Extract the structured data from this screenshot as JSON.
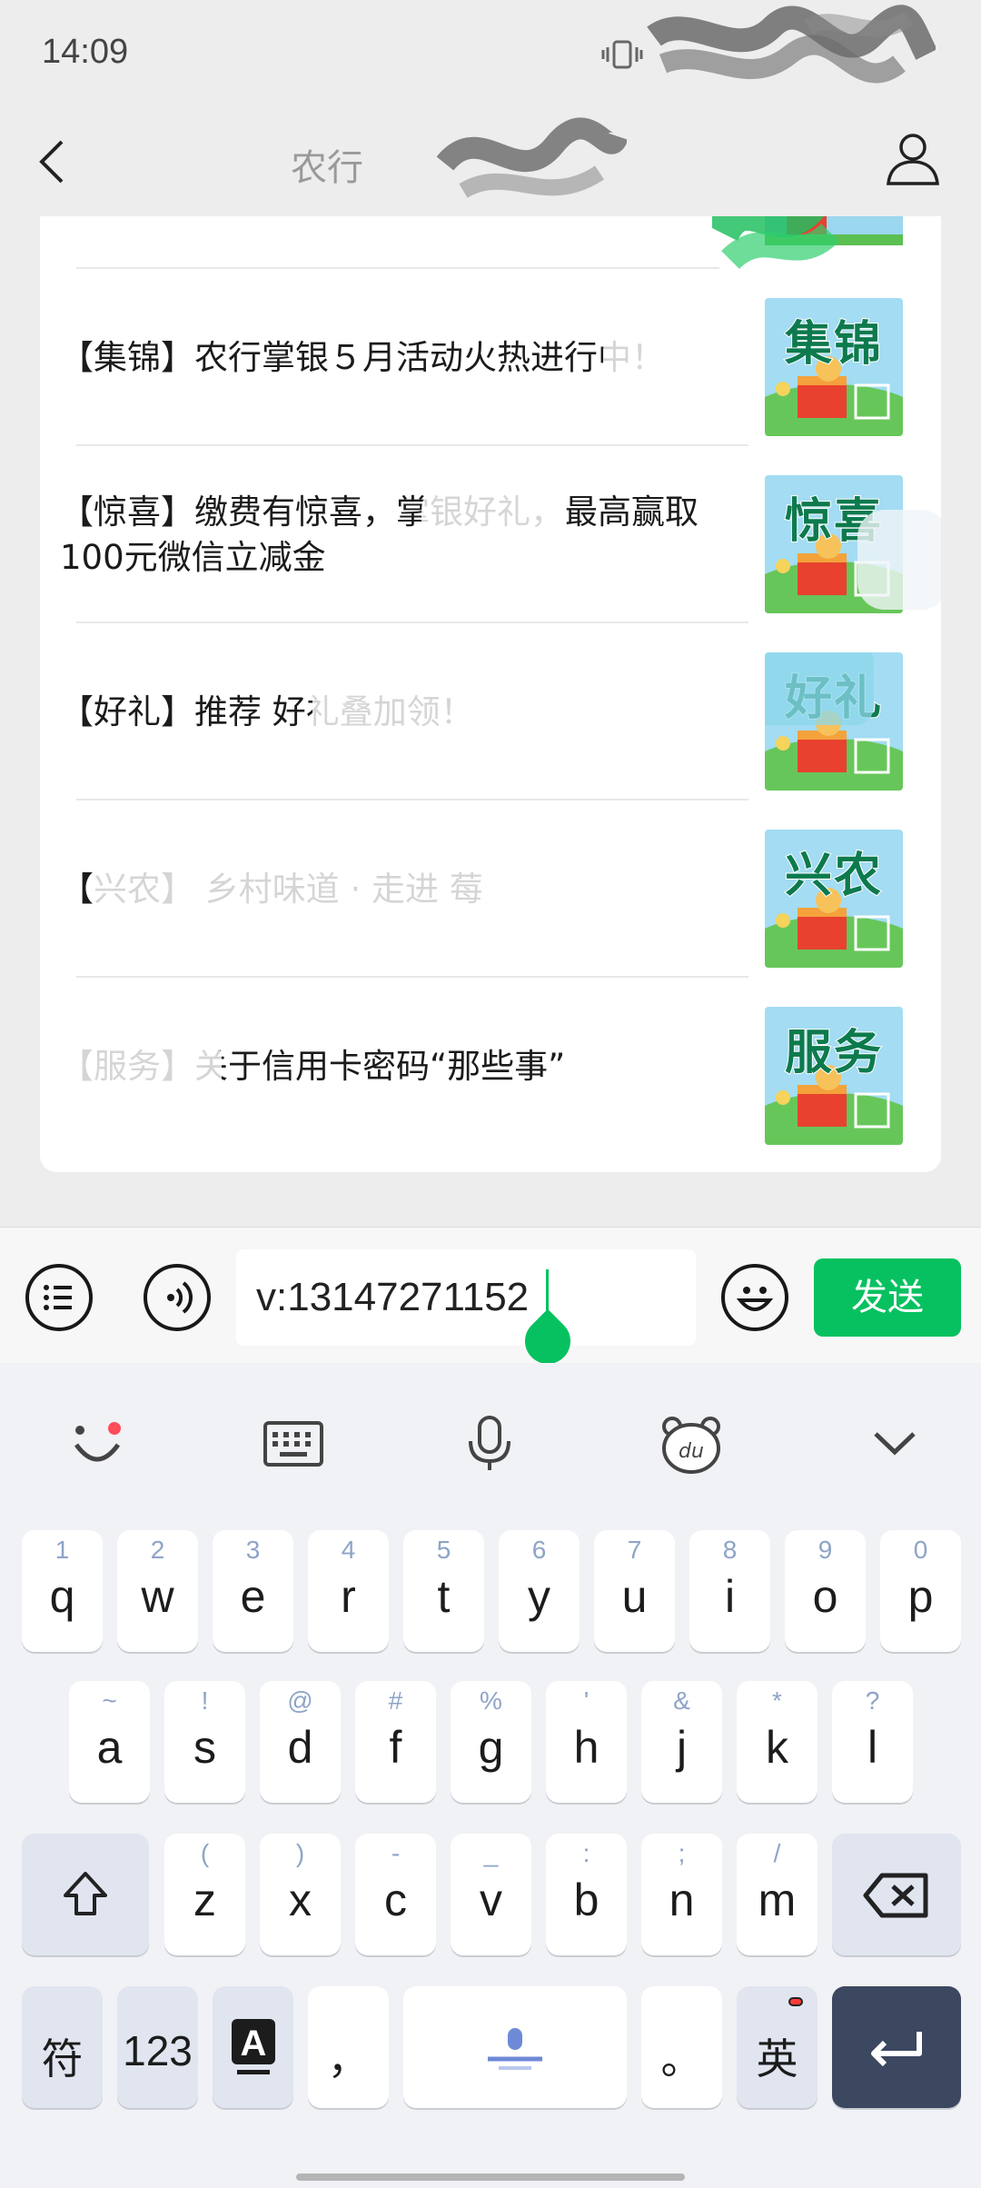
{
  "status_bar": {
    "time": "14:09"
  },
  "nav": {
    "title": "农行 "
  },
  "articles": [
    {
      "title": "【集锦】农行掌银５月活动火热进行中！",
      "thumb": "集锦"
    },
    {
      "title": "【惊喜】缴费有惊喜，掌银好礼，最高赢取100元微信立减金",
      "thumb": "惊喜"
    },
    {
      "title": "【好礼】推荐 好礼叠加领！",
      "thumb": "好礼"
    },
    {
      "title": "【兴农】 乡村味道 · 走进 莓",
      "thumb": "兴农"
    },
    {
      "title": "【服务】关于信用卡密码“那些事”",
      "thumb": "服务"
    }
  ],
  "input": {
    "value": "v:13147271152",
    "send_label": "发送"
  },
  "keyboard": {
    "row1": [
      {
        "hint": "1",
        "char": "q"
      },
      {
        "hint": "2",
        "char": "w"
      },
      {
        "hint": "3",
        "char": "e"
      },
      {
        "hint": "4",
        "char": "r"
      },
      {
        "hint": "5",
        "char": "t"
      },
      {
        "hint": "6",
        "char": "y"
      },
      {
        "hint": "7",
        "char": "u"
      },
      {
        "hint": "8",
        "char": "i"
      },
      {
        "hint": "9",
        "char": "o"
      },
      {
        "hint": "0",
        "char": "p"
      }
    ],
    "row2": [
      {
        "hint": "~",
        "char": "a"
      },
      {
        "hint": "!",
        "char": "s"
      },
      {
        "hint": "@",
        "char": "d"
      },
      {
        "hint": "#",
        "char": "f"
      },
      {
        "hint": "%",
        "char": "g"
      },
      {
        "hint": "'",
        "char": "h"
      },
      {
        "hint": "&",
        "char": "j"
      },
      {
        "hint": "*",
        "char": "k"
      },
      {
        "hint": "?",
        "char": "l"
      }
    ],
    "row3": [
      {
        "hint": "(",
        "char": "z"
      },
      {
        "hint": ")",
        "char": "x"
      },
      {
        "hint": "-",
        "char": "c"
      },
      {
        "hint": "_",
        "char": "v"
      },
      {
        "hint": ":",
        "char": "b"
      },
      {
        "hint": ";",
        "char": "n"
      },
      {
        "hint": "/",
        "char": "m"
      }
    ],
    "symbols_label": "符",
    "numbers_label": "123",
    "comma_label": "，",
    "period_label": "。",
    "language_label": "英"
  }
}
